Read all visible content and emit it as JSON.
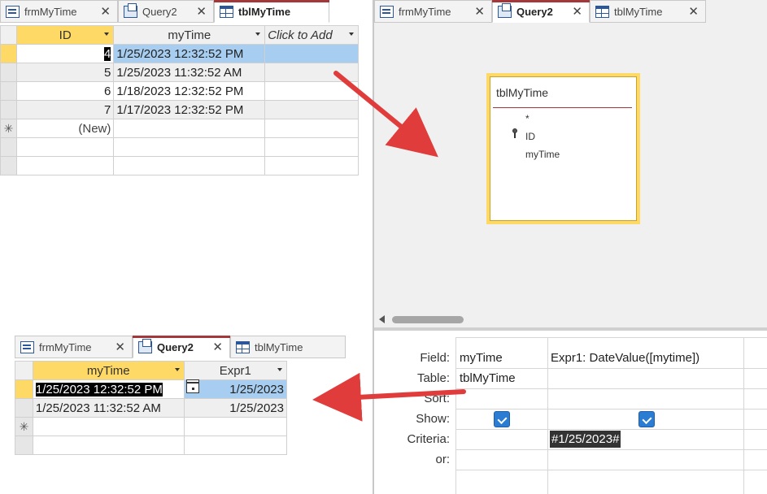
{
  "table_window": {
    "tabs": [
      {
        "label": "frmMyTime",
        "icon": "form-icon",
        "active": false
      },
      {
        "label": "Query2",
        "icon": "query-icon",
        "active": false
      },
      {
        "label": "tblMyTime",
        "icon": "table-icon",
        "active": true
      }
    ],
    "columns": [
      "ID",
      "myTime",
      "Click to Add"
    ],
    "rows": [
      {
        "id": "4",
        "time": "1/25/2023 12:32:52 PM"
      },
      {
        "id": "5",
        "time": "1/25/2023 11:32:52 AM"
      },
      {
        "id": "6",
        "time": "1/18/2023 12:32:52 PM"
      },
      {
        "id": "7",
        "time": "1/17/2023 12:32:52 PM"
      }
    ],
    "new_row": "(New)",
    "new_row_marker": "✳"
  },
  "design_window": {
    "tabs": [
      {
        "label": "frmMyTime",
        "icon": "form-icon",
        "active": false
      },
      {
        "label": "Query2",
        "icon": "query-icon",
        "active": true
      },
      {
        "label": "tblMyTime",
        "icon": "table-icon",
        "active": false
      }
    ],
    "field_list": {
      "title": "tblMyTime",
      "items": [
        "*",
        "ID",
        "myTime"
      ]
    },
    "qbe": {
      "labels": [
        "Field:",
        "Table:",
        "Sort:",
        "Show:",
        "Criteria:",
        "or:"
      ],
      "col1": {
        "field": "myTime",
        "table": "tblMyTime",
        "show": true
      },
      "col2": {
        "field": "Expr1: DateValue([mytime])",
        "show": true,
        "criteria": "#1/25/2023#"
      }
    }
  },
  "result_window": {
    "tabs": [
      {
        "label": "frmMyTime",
        "icon": "form-icon",
        "active": false
      },
      {
        "label": "Query2",
        "icon": "query-icon",
        "active": true
      },
      {
        "label": "tblMyTime",
        "icon": "table-icon",
        "active": false
      }
    ],
    "columns": [
      "myTime",
      "Expr1"
    ],
    "rows": [
      {
        "time": "1/25/2023 12:32:52 PM",
        "expr": "1/25/2023"
      },
      {
        "time": "1/25/2023 11:32:52 AM",
        "expr": "1/25/2023"
      }
    ],
    "new_row_marker": "✳"
  },
  "colors": {
    "accent": "#a4373a",
    "selected_header": "#ffd966",
    "selected_cell": "#a7cdf0",
    "arrow": "#e03c3c"
  }
}
